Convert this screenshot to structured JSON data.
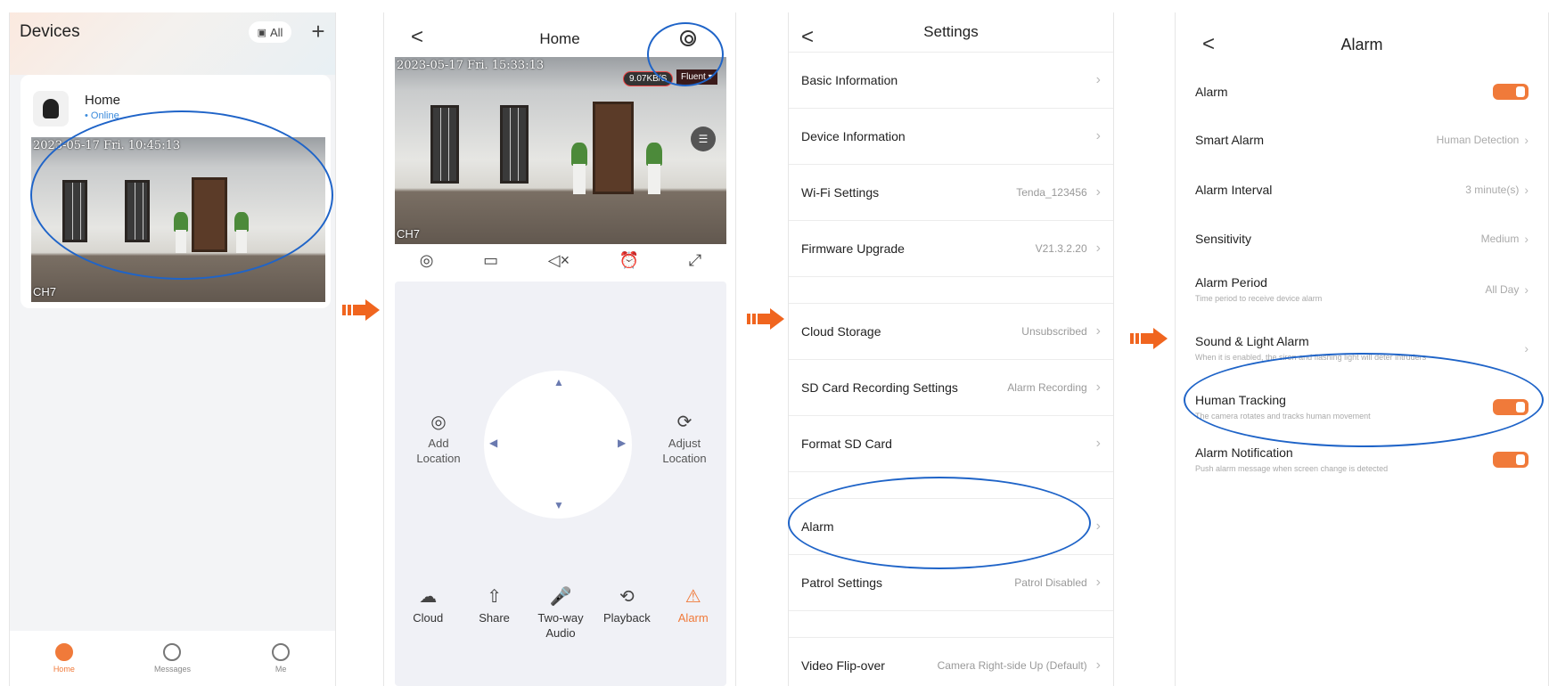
{
  "screen1": {
    "title": "Devices",
    "all_label": "All",
    "add_label": "+",
    "device": {
      "name": "Home",
      "status": "• Online",
      "timestamp": "2023-05-17 Fri.  10:45:13",
      "channel": "CH7"
    },
    "tabs": [
      {
        "label": "Home",
        "icon": "camera-icon"
      },
      {
        "label": "Messages",
        "icon": "chat-icon"
      },
      {
        "label": "Me",
        "icon": "person-icon"
      }
    ]
  },
  "screen2": {
    "title": "Home",
    "back": "<",
    "timestamp": "2023-05-17  Fri.   15:33:13",
    "rate": "9.07KB/S",
    "quality": "Fluent ▾",
    "channel": "CH7",
    "tools": [
      "◎",
      "▭",
      "◁×",
      "⏰",
      "⤢"
    ],
    "add_location": "Add Location",
    "adjust_location": "Adjust Location",
    "actions": [
      {
        "label": "Cloud",
        "icon": "☁"
      },
      {
        "label": "Share",
        "icon": "⇧"
      },
      {
        "label": "Two-way Audio",
        "icon": "🎤"
      },
      {
        "label": "Playback",
        "icon": "⟲"
      },
      {
        "label": "Alarm",
        "icon": "⚠"
      }
    ]
  },
  "screen3": {
    "title": "Settings",
    "back": "<",
    "rows1": [
      {
        "label": "Basic Information",
        "value": ""
      },
      {
        "label": "Device Information",
        "value": ""
      },
      {
        "label": "Wi-Fi Settings",
        "value": "Tenda_123456"
      },
      {
        "label": "Firmware Upgrade",
        "value": "V21.3.2.20"
      }
    ],
    "rows2": [
      {
        "label": "Cloud Storage",
        "value": "Unsubscribed"
      },
      {
        "label": "SD Card Recording Settings",
        "value": "Alarm Recording"
      },
      {
        "label": "Format SD Card",
        "value": ""
      }
    ],
    "rows3": [
      {
        "label": "Alarm",
        "value": ""
      },
      {
        "label": "Patrol Settings",
        "value": "Patrol Disabled"
      }
    ],
    "rows4": [
      {
        "label": "Video Flip-over",
        "value": "Camera Right-side Up (Default)"
      }
    ]
  },
  "screen4": {
    "title": "Alarm",
    "back": "<",
    "alarm": "Alarm",
    "smart_alarm": "Smart Alarm",
    "smart_alarm_value": "Human Detection",
    "interval": "Alarm Interval",
    "interval_value": "3 minute(s)",
    "sensitivity": "Sensitivity",
    "sensitivity_value": "Medium",
    "period": "Alarm Period",
    "period_sub": "Time period to receive device alarm",
    "period_value": "All Day",
    "sound": "Sound & Light Alarm",
    "sound_sub": "When it is enabled, the siren and flashing light will deter intruders",
    "tracking": "Human Tracking",
    "tracking_sub": "The camera rotates and tracks human movement",
    "notification": "Alarm Notification",
    "notification_sub": "Push alarm message when screen change is detected"
  },
  "colors": {
    "accent": "#f07a3a",
    "annotation": "#1f64c8"
  }
}
